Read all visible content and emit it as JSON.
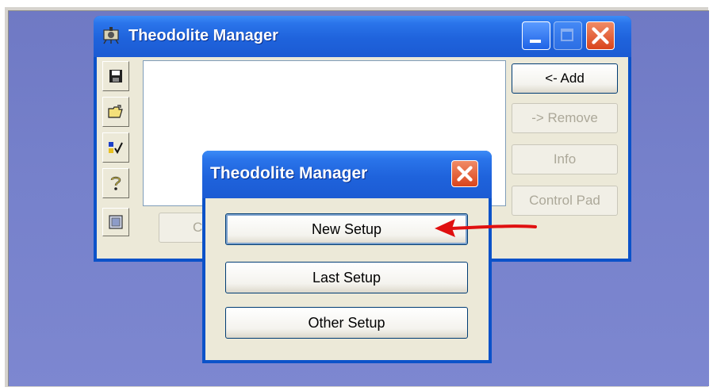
{
  "main_window": {
    "title": "Theodolite Manager",
    "side_icons": [
      "save-icon",
      "open-folder-icon",
      "check-list-icon",
      "help-icon",
      "panel-icon"
    ],
    "buttons": {
      "add": "<- Add",
      "remove": "-> Remove",
      "info": "Info",
      "control_pad": "Control Pad",
      "bottom_partial": "C"
    }
  },
  "dialog": {
    "title": "Theodolite Manager",
    "buttons": {
      "new_setup": "New Setup",
      "last_setup": "Last Setup",
      "other_setup": "Other Setup"
    }
  },
  "colors": {
    "titlebar_blue": "#1f63dc",
    "close_red": "#d9441c",
    "arrow_red": "#e01010",
    "desktop": "#7681cb"
  }
}
